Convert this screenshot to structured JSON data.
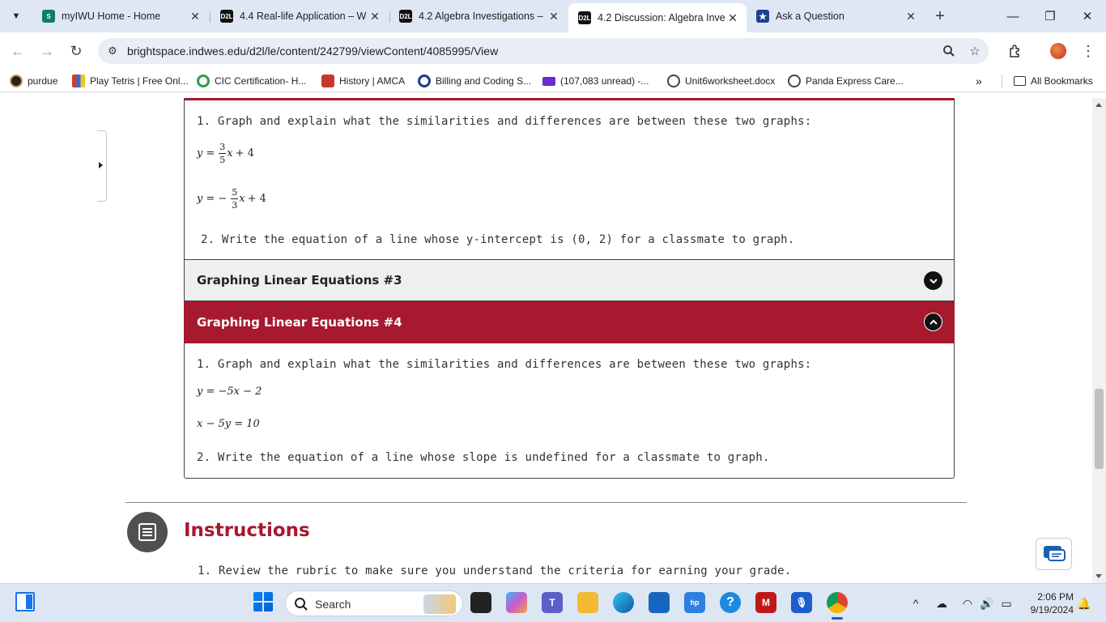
{
  "browser": {
    "tabs": [
      {
        "title": "myIWU Home - Home",
        "favicon_color": "#0f7b6c",
        "favicon_text": "S"
      },
      {
        "title": "4.4 Real-life Application – W",
        "favicon_color": "#111111",
        "favicon_text": "D2L"
      },
      {
        "title": "4.2 Algebra Investigations –",
        "favicon_color": "#111111",
        "favicon_text": "D2L"
      },
      {
        "title": "4.2 Discussion: Algebra Inve",
        "favicon_color": "#111111",
        "favicon_text": "D2L"
      },
      {
        "title": "Ask a Question",
        "favicon_color": "#1d3f8f",
        "favicon_text": "★"
      }
    ],
    "url": "brightspace.indwes.edu/d2l/le/content/242799/viewContent/4085995/View",
    "bookmarks": [
      "purdue",
      "Play Tetris | Free Onl...",
      "CIC Certification- H...",
      "History | AMCA",
      "Billing and Coding S...",
      "(107,083 unread) -...",
      "Unit6worksheet.docx",
      "Panda Express Care..."
    ],
    "all_bookmarks": "All Bookmarks"
  },
  "content": {
    "panel1": {
      "q1": "1. Graph and explain what the similarities and differences are between these two graphs:",
      "eq1": {
        "lhs": "y",
        "eq": "=",
        "num": "3",
        "den": "5",
        "var": "x",
        "rest": "+ 4"
      },
      "eq2": {
        "lhs": "y",
        "eq": "= −",
        "num": "5",
        "den": "3",
        "var": "x",
        "rest": "+ 4"
      },
      "q2": "2. Write the equation of a line whose y-intercept is (0, 2) for a classmate to graph."
    },
    "accordion3": "Graphing Linear Equations #3",
    "accordion4": "Graphing Linear Equations #4",
    "panel2": {
      "q1": "1. Graph and explain what the similarities and differences are between these two graphs:",
      "eq1": "y =  −5x − 2",
      "eq2": "x − 5y = 10",
      "q2": "2. Write the equation of a line whose slope is undefined for a classmate to graph."
    },
    "instructions": {
      "title": "Instructions",
      "item1": "1. Review the rubric to make sure you understand the criteria for earning your grade."
    }
  },
  "taskbar": {
    "search_text": "Search",
    "time": "2:06 PM",
    "date": "9/19/2024"
  },
  "colors": {
    "accent": "#a6192e",
    "panel_gray": "#efefef"
  }
}
